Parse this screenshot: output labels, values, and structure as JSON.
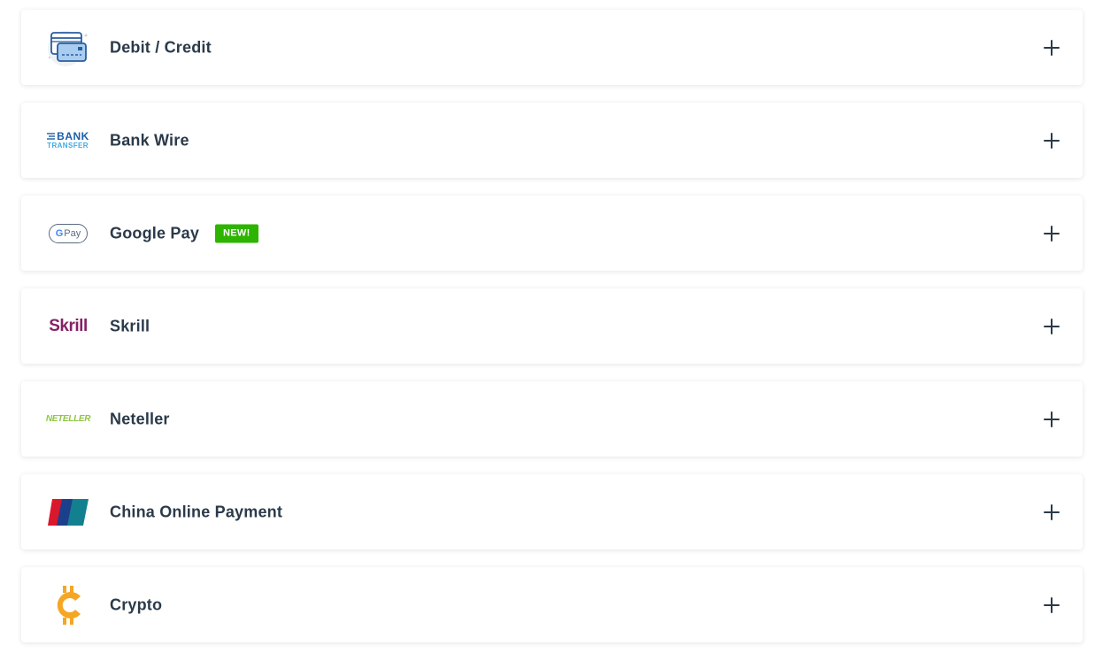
{
  "payment_methods": [
    {
      "label": "Debit / Credit",
      "icon": "credit-card-icon",
      "badge": ""
    },
    {
      "label": "Bank Wire",
      "icon": "bank-transfer-logo",
      "logo_text_top": "BANK",
      "logo_text_bottom": "TRANSFER",
      "badge": ""
    },
    {
      "label": "Google Pay",
      "icon": "google-pay-logo",
      "logo_text_g": "G",
      "logo_text_pay": "Pay",
      "badge": "NEW!"
    },
    {
      "label": "Skrill",
      "icon": "skrill-logo",
      "logo_text": "Skrill",
      "badge": ""
    },
    {
      "label": "Neteller",
      "icon": "neteller-logo",
      "logo_text": "NETELLER",
      "badge": ""
    },
    {
      "label": "China Online Payment",
      "icon": "unionpay-logo",
      "badge": ""
    },
    {
      "label": "Crypto",
      "icon": "crypto-coin-icon",
      "badge": ""
    }
  ],
  "expand_icon": "plus-icon",
  "colors": {
    "text": "#2b3a4a",
    "badge_bg": "#2db400",
    "skrill": "#862165",
    "neteller": "#8dc63f",
    "crypto": "#f5a623",
    "bank_dark": "#1c5ea8",
    "bank_light": "#3fa9e0"
  }
}
